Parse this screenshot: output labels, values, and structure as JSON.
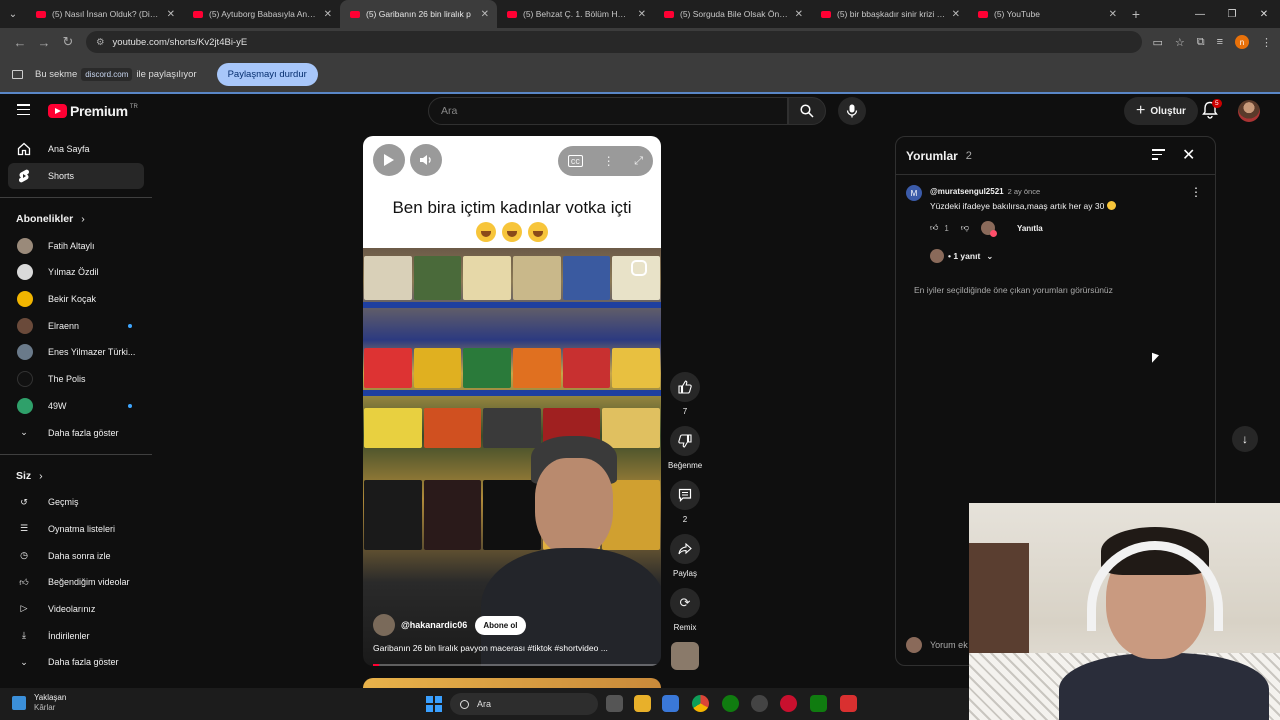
{
  "browser": {
    "tabs": [
      {
        "title": "(5) Nasıl İnsan Olduk? (Diğer Tü",
        "active": false
      },
      {
        "title": "(5) Aytuborg Babasıyla Ankara'",
        "active": false
      },
      {
        "title": "(5) Garibanın 26 bin liralık p",
        "active": true
      },
      {
        "title": "(5) Behzat Ç. 1. Bölüm HD - Yo",
        "active": false
      },
      {
        "title": "(5) Sorguda Bile Olsak Önce Ha",
        "active": false
      },
      {
        "title": "(5) bir bbaşkadır sinir krizi - You",
        "active": false
      },
      {
        "title": "(5) YouTube",
        "active": false
      }
    ],
    "new_tab": "+",
    "url": "youtube.com/shorts/Kv2jt4Bi-yE",
    "profile_initial": "n"
  },
  "share_bar": {
    "prefix": "Bu sekme",
    "domain": "discord.com",
    "suffix": "ile paylaşılıyor",
    "stop_button": "Paylaşmayı durdur"
  },
  "yt_header": {
    "logo": "Premium",
    "region": "TR",
    "search_placeholder": "Ara",
    "create_label": "Oluştur",
    "notification_count": "5"
  },
  "sidebar": {
    "main": [
      {
        "label": "Ana Sayfa",
        "icon": "home-icon"
      },
      {
        "label": "Shorts",
        "icon": "shorts-icon",
        "active": true
      }
    ],
    "subscriptions_title": "Abonelikler",
    "subscriptions": [
      {
        "label": "Fatih Altaylı",
        "color": "#9a8a7a",
        "dot": false
      },
      {
        "label": "Yılmaz Özdil",
        "color": "#d9d9d9",
        "dot": false
      },
      {
        "label": "Bekir Koçak",
        "color": "#f1b500",
        "dot": false
      },
      {
        "label": "Elraenn",
        "color": "#6a4a3a",
        "dot": true
      },
      {
        "label": "Enes Yilmazer Türki...",
        "color": "#6a7a8a",
        "dot": false
      },
      {
        "label": "The Polis",
        "color": "#111111",
        "dot": false
      },
      {
        "label": "49W",
        "color": "#2fa06a",
        "dot": true
      }
    ],
    "show_more": "Daha fazla göster",
    "you_title": "Siz",
    "you_items": [
      {
        "label": "Geçmiş",
        "icon": "history-icon"
      },
      {
        "label": "Oynatma listeleri",
        "icon": "playlist-icon"
      },
      {
        "label": "Daha sonra izle",
        "icon": "clock-icon"
      },
      {
        "label": "Beğendiğim videolar",
        "icon": "like-icon"
      },
      {
        "label": "Videolarınız",
        "icon": "video-icon"
      },
      {
        "label": "İndirilenler",
        "icon": "download-icon"
      }
    ],
    "show_more_2": "Daha fazla göster"
  },
  "short": {
    "caption_line": "Ben bira içtim kadınlar votka içti",
    "channel": "@hakanardic06",
    "subscribe": "Abone ol",
    "title": "Garibanın 26 bin liralık pavyon macerası #tiktok #shortvideo ...",
    "progress": 0.02
  },
  "actions": {
    "likes": "7",
    "dislike_label": "Beğenme",
    "comments": "2",
    "share_label": "Paylaş",
    "remix_label": "Remix"
  },
  "comments": {
    "title": "Yorumlar",
    "count": "2",
    "item": {
      "avatar_letter": "M",
      "user": "@muratsengul2521",
      "time": "2 ay önce",
      "text": "Yüzdeki ifadeye bakılırsa,maaş artık her ay 30",
      "likes": "1",
      "reply_label": "Yanıtla",
      "replies": "1 yanıt"
    },
    "note": "En iyiler seçildiğinde öne çıkan yorumları görürsünüz",
    "input_placeholder": "Yorum ek"
  },
  "taskbar": {
    "weather_title": "Yaklaşan",
    "weather_sub": "Kârlar",
    "search": "Ara"
  }
}
